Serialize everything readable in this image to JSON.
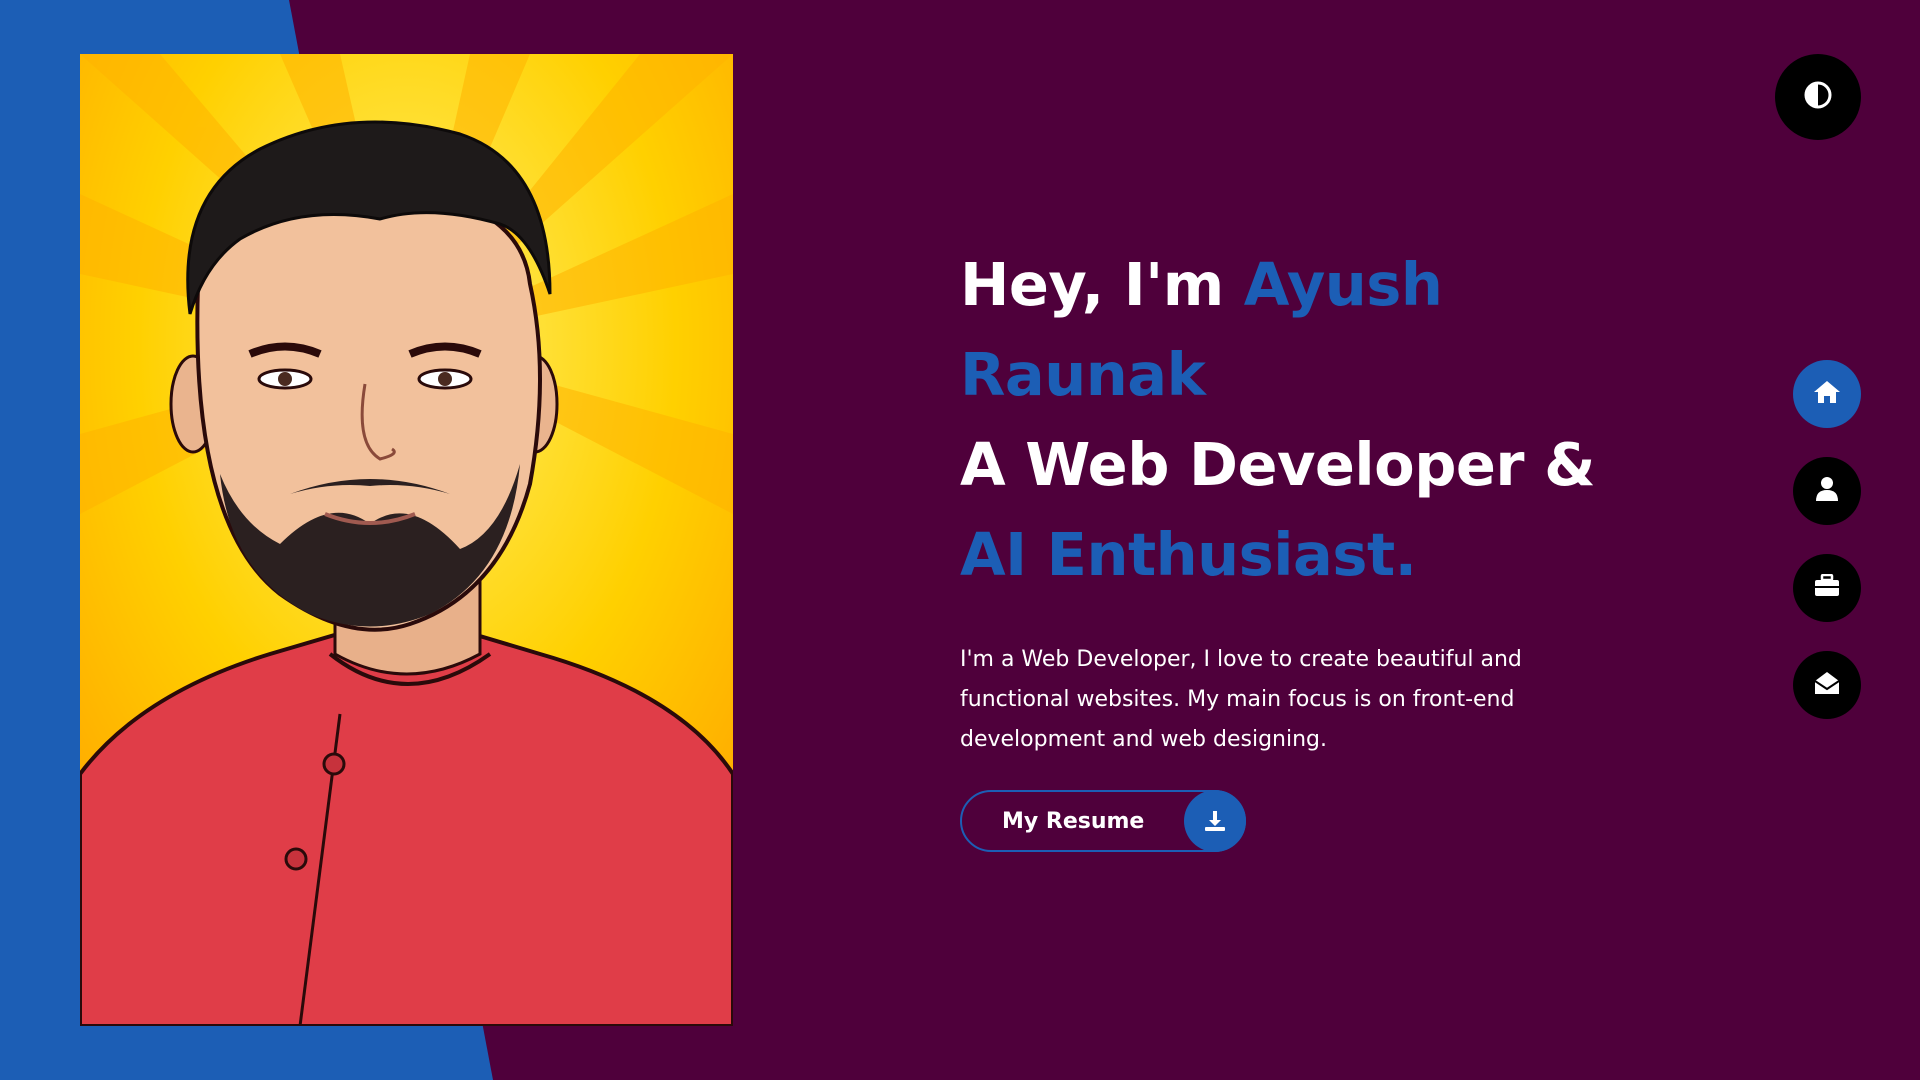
{
  "colors": {
    "background": "#4f003b",
    "accent": "#1c5eb5",
    "text": "#ffffff",
    "icon_button": "#000000"
  },
  "portrait": {
    "description_icon": "cartoon-portrait"
  },
  "hero": {
    "greeting": "Hey, I'm ",
    "name_part1": "Ayush",
    "name_part2": "Raunak",
    "role_line": "A Web Developer &",
    "role_accent": "AI Enthusiast.",
    "bio": "I'm a Web Developer, I love to create beautiful and functional websites. My main focus is on front-end development and web designing.",
    "resume_label": "My Resume"
  },
  "icons": {
    "theme_toggle": "contrast-icon",
    "resume_download": "download-icon",
    "nav": [
      "home-icon",
      "user-icon",
      "briefcase-icon",
      "envelope-open-icon"
    ]
  },
  "nav": {
    "active_index": 0
  }
}
